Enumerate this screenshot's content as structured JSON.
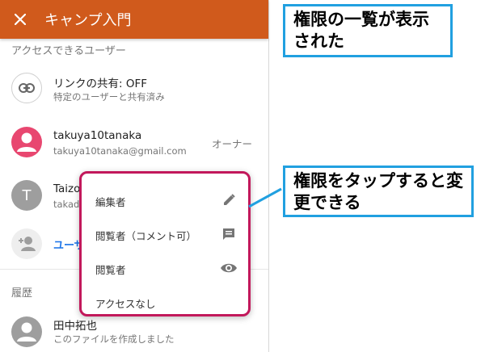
{
  "app_bar": {
    "title": "キャンプ入門",
    "close_icon": "close-icon",
    "background": "#d05a1c"
  },
  "access_section": {
    "heading": "アクセスできるユーザー"
  },
  "link_share": {
    "title": "リンクの共有: OFF",
    "subtitle": "特定のユーザーと共有済み",
    "icon": "link-icon"
  },
  "owner_user": {
    "name": "takuya10tanaka",
    "email": "takuya10tanaka@gmail.com",
    "role": "オーナー",
    "avatar_color": "#e84770"
  },
  "second_user": {
    "name_partial": "Taizo",
    "email_partial": "takad",
    "avatar_letter": "T",
    "avatar_color": "#9e9e9e"
  },
  "add_user": {
    "label_partial": "ユーザ",
    "icon": "add-person-icon"
  },
  "history_section": {
    "heading": "履歴"
  },
  "history_item": {
    "name": "田中拓也",
    "action": "このファイルを作成しました"
  },
  "permission_menu": {
    "border_color": "#c2185b",
    "items": [
      {
        "label": "編集者",
        "icon": "pencil-icon"
      },
      {
        "label": "閲覧者（コメント可）",
        "icon": "comment-icon"
      },
      {
        "label": "閲覧者",
        "icon": "eye-icon"
      },
      {
        "label": "アクセスなし",
        "icon": ""
      }
    ]
  },
  "callouts": {
    "top": "権限の一覧が表示された",
    "middle": "権限をタップすると変更できる",
    "border_color": "#21a0e0"
  }
}
